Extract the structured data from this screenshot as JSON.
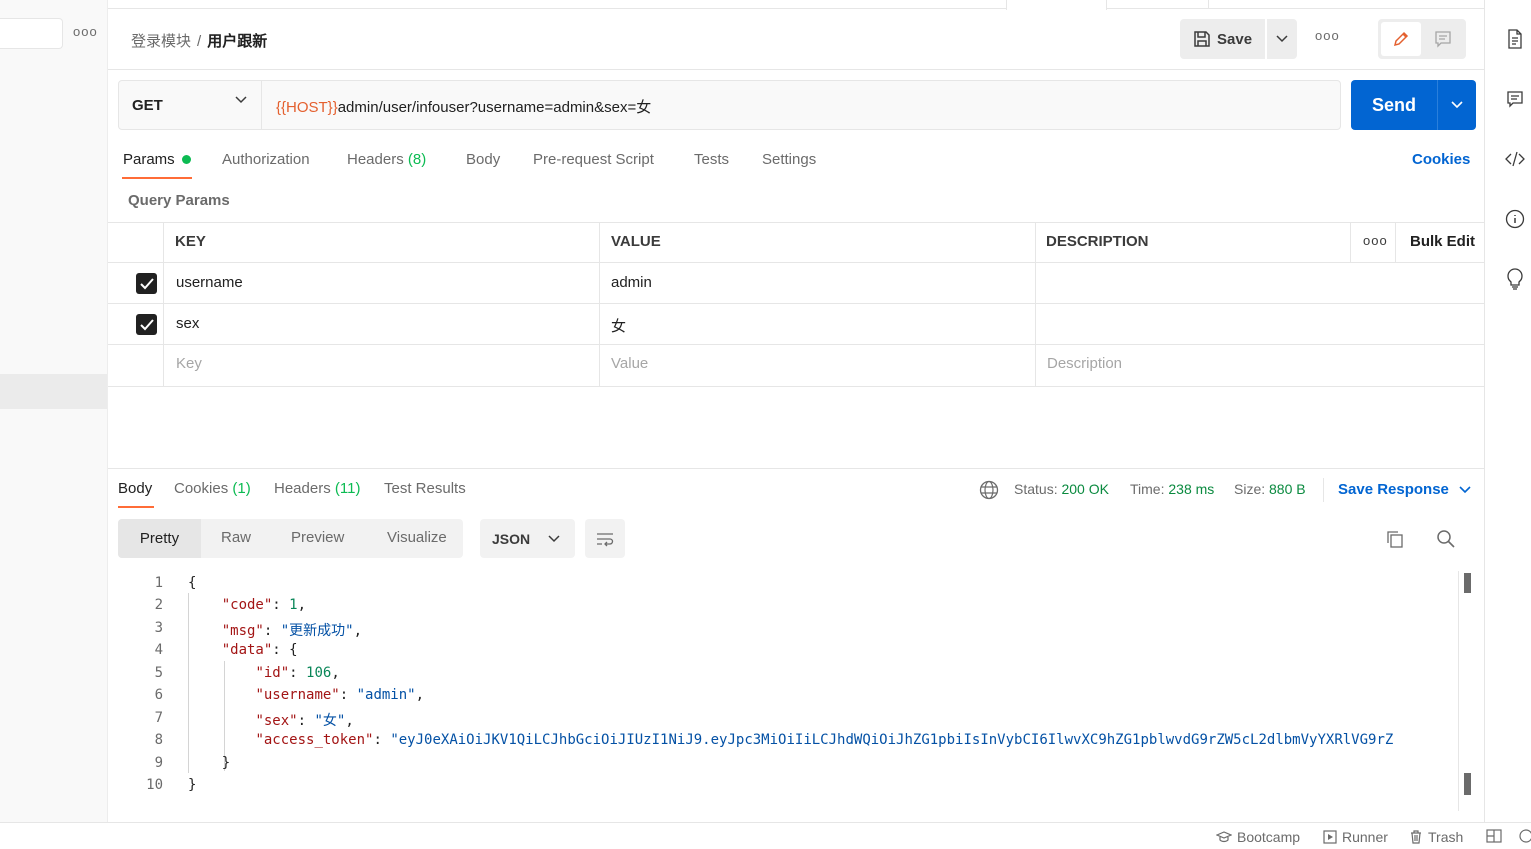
{
  "sidebar": {
    "more_icon": "ooo"
  },
  "header": {
    "breadcrumb_parent": "登录模块",
    "breadcrumb_sep": "/",
    "breadcrumb_current": "用户跟新",
    "save_label": "Save",
    "more_icon": "ooo"
  },
  "request": {
    "method": "GET",
    "url_var": "{{HOST}}",
    "url_rest": "admin/user/infouser?username=admin&sex=女",
    "send_label": "Send"
  },
  "request_tabs": {
    "params": "Params",
    "authorization": "Authorization",
    "headers": "Headers",
    "headers_count": "(8)",
    "body": "Body",
    "prerequest": "Pre-request Script",
    "tests": "Tests",
    "settings": "Settings",
    "cookies": "Cookies"
  },
  "query_params": {
    "title": "Query Params",
    "columns": {
      "key": "KEY",
      "value": "VALUE",
      "description": "DESCRIPTION",
      "more": "ooo",
      "bulk_edit": "Bulk Edit"
    },
    "rows": [
      {
        "key": "username",
        "value": "admin",
        "checked": true
      },
      {
        "key": "sex",
        "value": "女",
        "checked": true
      }
    ],
    "placeholders": {
      "key": "Key",
      "value": "Value",
      "description": "Description"
    }
  },
  "response": {
    "tabs": {
      "body": "Body",
      "cookies": "Cookies",
      "cookies_count": "(1)",
      "headers": "Headers",
      "headers_count": "(11)",
      "test_results": "Test Results"
    },
    "status_label": "Status:",
    "status_value": "200 OK",
    "time_label": "Time:",
    "time_value": "238 ms",
    "size_label": "Size:",
    "size_value": "880 B",
    "save_response": "Save Response",
    "views": {
      "pretty": "Pretty",
      "raw": "Raw",
      "preview": "Preview",
      "visualize": "Visualize"
    },
    "format": "JSON",
    "line_numbers": [
      "1",
      "2",
      "3",
      "4",
      "5",
      "6",
      "7",
      "8",
      "9",
      "10"
    ],
    "code": {
      "l1": "{",
      "code_key": "\"code\"",
      "code_val": "1",
      "msg_key": "\"msg\"",
      "msg_val": "\"更新成功\"",
      "data_key": "\"data\"",
      "id_key": "\"id\"",
      "id_val": "106",
      "username_key": "\"username\"",
      "username_val": "\"admin\"",
      "sex_key": "\"sex\"",
      "sex_val": "\"女\"",
      "token_key": "\"access_token\"",
      "token_val": "\"eyJ0eXAiOiJKV1QiLCJhbGciOiJIUzI1NiJ9.eyJpc3MiOiIiLCJhdWQiOiJhZG1pbiIsInVybCI6IlwvXC9hZG1pblwvdG9rZW5cL2dlbmVyYXRlVG9rZ",
      "l9": "}",
      "l10": "}"
    }
  },
  "status_bar": {
    "bootcamp": "Bootcamp",
    "runner": "Runner",
    "trash": "Trash"
  }
}
